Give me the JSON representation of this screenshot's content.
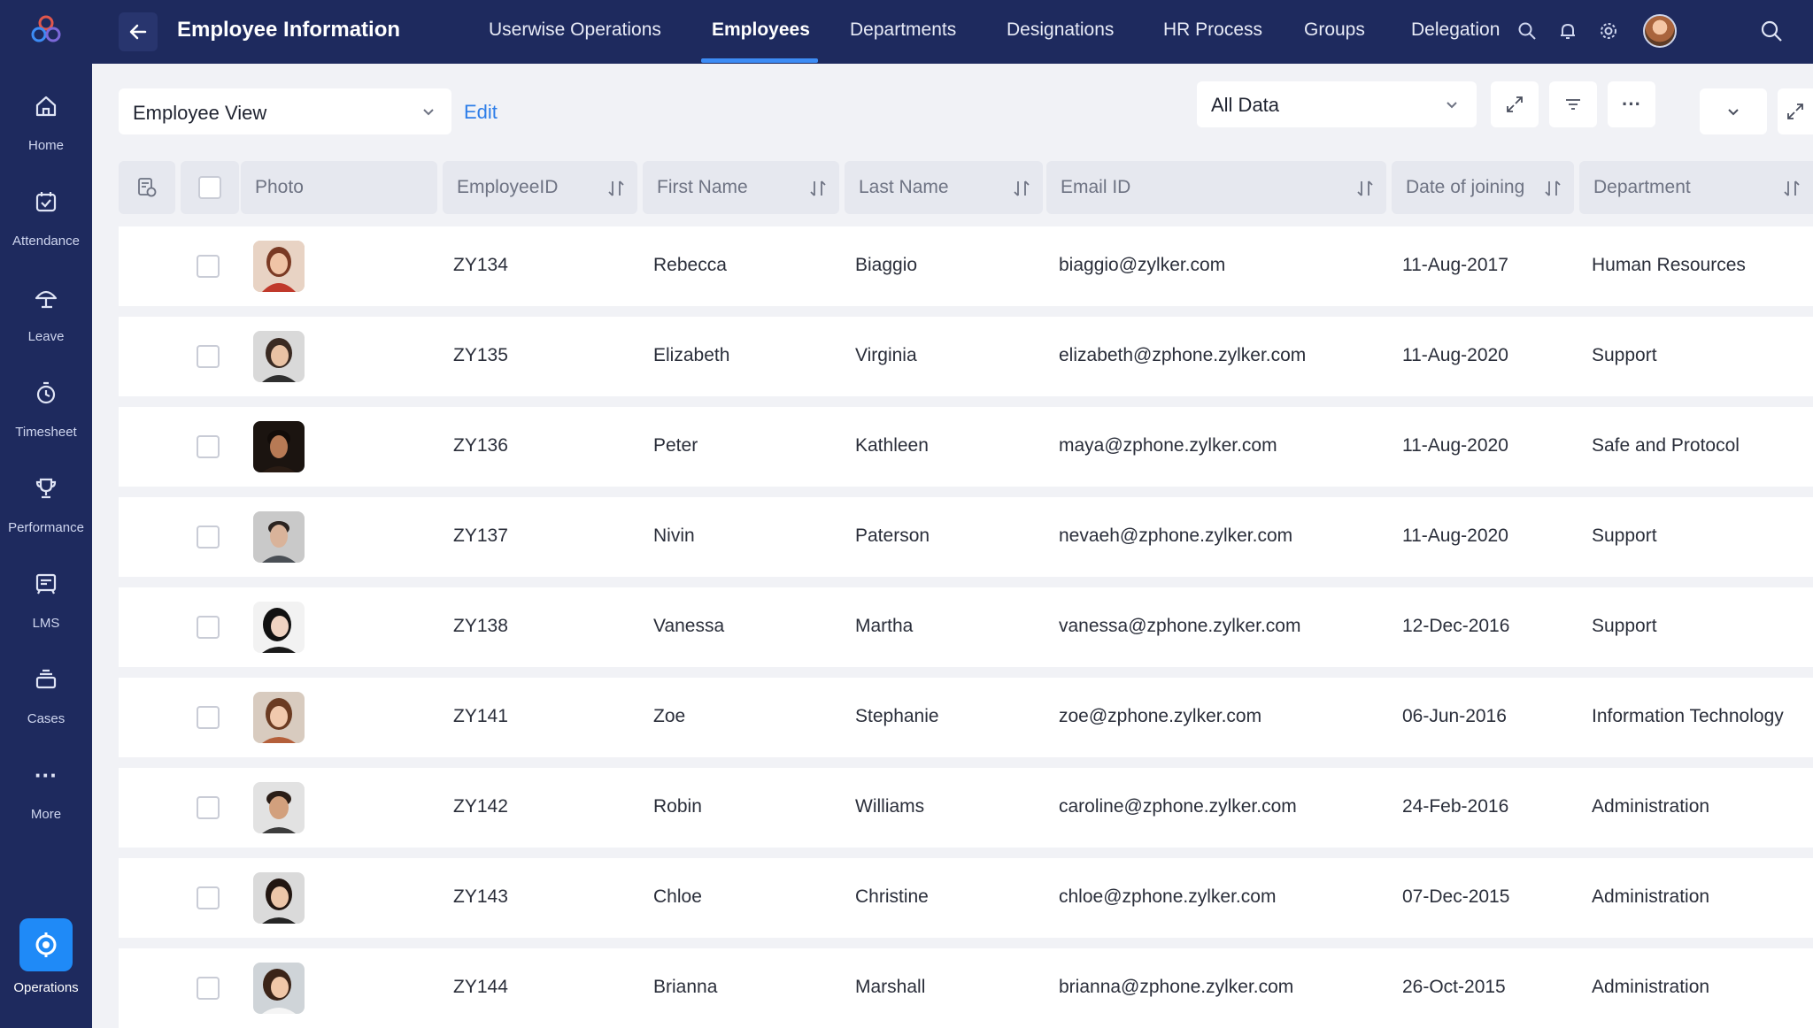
{
  "sidebar": {
    "items": [
      {
        "label": "Home",
        "icon": "home-icon"
      },
      {
        "label": "Attendance",
        "icon": "calendar-check-icon"
      },
      {
        "label": "Leave",
        "icon": "umbrella-icon"
      },
      {
        "label": "Timesheet",
        "icon": "timer-icon"
      },
      {
        "label": "Performance",
        "icon": "trophy-icon"
      },
      {
        "label": "LMS",
        "icon": "book-screen-icon"
      },
      {
        "label": "Cases",
        "icon": "stack-icon"
      },
      {
        "label": "More",
        "icon": "more-icon"
      },
      {
        "label": "Operations",
        "icon": "operations-icon"
      }
    ]
  },
  "header": {
    "title": "Employee Information",
    "tabs": [
      {
        "label": "Userwise Operations"
      },
      {
        "label": "Employees",
        "active": true
      },
      {
        "label": "Departments"
      },
      {
        "label": "Designations"
      },
      {
        "label": "HR Process"
      },
      {
        "label": "Groups"
      },
      {
        "label": "Delegation"
      }
    ]
  },
  "toolbar": {
    "view_label": "Employee View",
    "edit_label": "Edit",
    "data_filter": "All Data"
  },
  "table": {
    "columns": [
      "Photo",
      "EmployeeID",
      "First Name",
      "Last Name",
      "Email ID",
      "Date of joining",
      "Department"
    ],
    "rows": [
      {
        "id": "ZY134",
        "first": "Rebecca",
        "last": "Biaggio",
        "email": "biaggio@zylker.com",
        "doj": "11-Aug-2017",
        "dept": "Human Resources"
      },
      {
        "id": "ZY135",
        "first": "Elizabeth",
        "last": "Virginia",
        "email": "elizabeth@zphone.zylker.com",
        "doj": "11-Aug-2020",
        "dept": "Support"
      },
      {
        "id": "ZY136",
        "first": "Peter",
        "last": "Kathleen",
        "email": "maya@zphone.zylker.com",
        "doj": "11-Aug-2020",
        "dept": "Safe and Protocol"
      },
      {
        "id": "ZY137",
        "first": "Nivin",
        "last": "Paterson",
        "email": "nevaeh@zphone.zylker.com",
        "doj": "11-Aug-2020",
        "dept": "Support"
      },
      {
        "id": "ZY138",
        "first": "Vanessa",
        "last": "Martha",
        "email": "vanessa@zphone.zylker.com",
        "doj": "12-Dec-2016",
        "dept": "Support"
      },
      {
        "id": "ZY141",
        "first": "Zoe",
        "last": "Stephanie",
        "email": "zoe@zphone.zylker.com",
        "doj": "06-Jun-2016",
        "dept": "Information Technology"
      },
      {
        "id": "ZY142",
        "first": "Robin",
        "last": "Williams",
        "email": "caroline@zphone.zylker.com",
        "doj": "24-Feb-2016",
        "dept": "Administration"
      },
      {
        "id": "ZY143",
        "first": "Chloe",
        "last": "Christine",
        "email": "chloe@zphone.zylker.com",
        "doj": "07-Dec-2015",
        "dept": "Administration"
      },
      {
        "id": "ZY144",
        "first": "Brianna",
        "last": "Marshall",
        "email": "brianna@zphone.zylker.com",
        "doj": "26-Oct-2015",
        "dept": "Administration"
      }
    ]
  },
  "colors": {
    "sidebar_bg": "#1e2a5e",
    "accent": "#3d8cf5",
    "link": "#2d7de8",
    "page_bg": "#f1f2f6"
  }
}
